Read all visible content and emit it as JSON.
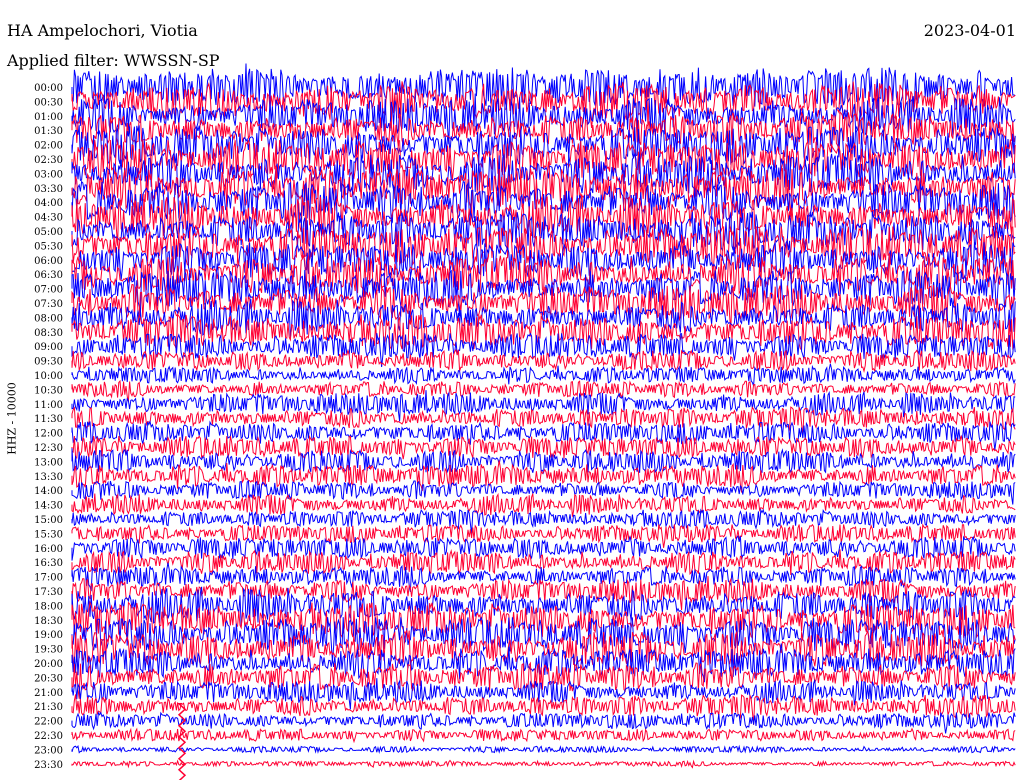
{
  "header": {
    "station": "HA Ampelochori, Viotia",
    "date": "2023-04-01",
    "filter": "Applied filter: WWSSN-SP"
  },
  "chart_data": {
    "type": "line",
    "title": "HA Ampelochori, Viotia",
    "subtitle": "Applied filter: WWSSN-SP",
    "ylabel": "HHZ - 10000",
    "xlabel": "",
    "date": "2023-04-01",
    "row_labels": [
      "00:00",
      "00:30",
      "01:00",
      "01:30",
      "02:00",
      "02:30",
      "03:00",
      "03:30",
      "04:00",
      "04:30",
      "05:00",
      "05:30",
      "06:00",
      "06:30",
      "07:00",
      "07:30",
      "08:00",
      "08:30",
      "09:00",
      "09:30",
      "10:00",
      "10:30",
      "11:00",
      "11:30",
      "12:00",
      "12:30",
      "13:00",
      "13:30",
      "14:00",
      "14:30",
      "15:00",
      "15:30",
      "16:00",
      "16:30",
      "17:00",
      "17:30",
      "18:00",
      "18:30",
      "19:00",
      "19:30",
      "20:00",
      "20:30",
      "21:00",
      "21:30",
      "22:00",
      "22:30",
      "23:00",
      "23:30"
    ],
    "series_colors": [
      "#0000ff",
      "#ff0033"
    ],
    "relative_amplitude": [
      0.95,
      0.95,
      0.9,
      0.9,
      0.95,
      0.95,
      0.95,
      0.95,
      1.0,
      1.0,
      0.95,
      0.95,
      0.9,
      0.9,
      0.9,
      0.9,
      0.85,
      0.85,
      0.65,
      0.5,
      0.4,
      0.4,
      0.55,
      0.55,
      0.55,
      0.55,
      0.55,
      0.55,
      0.45,
      0.5,
      0.45,
      0.45,
      0.55,
      0.55,
      0.5,
      0.6,
      0.85,
      0.85,
      0.85,
      0.85,
      0.7,
      0.7,
      0.55,
      0.55,
      0.4,
      0.3,
      0.15,
      0.12
    ],
    "grid": false,
    "legend": "none"
  }
}
